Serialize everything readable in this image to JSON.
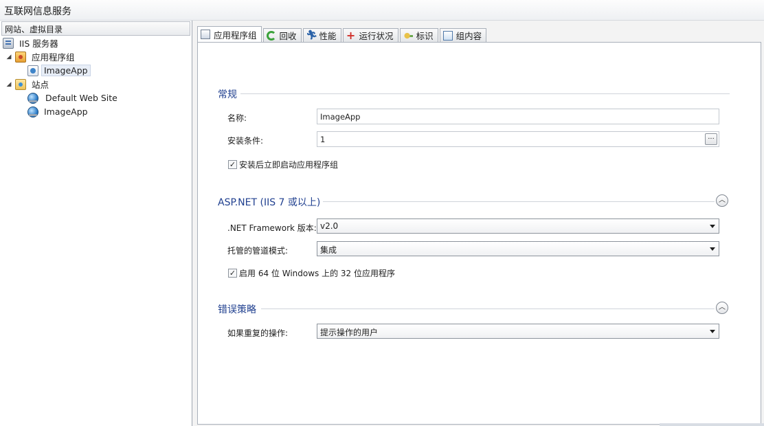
{
  "window": {
    "title": "互联网信息服务"
  },
  "left_pane": {
    "header": "网站、虚拟目录",
    "tree": [
      {
        "label": "IIS 服务器",
        "icon": "server-icon"
      },
      {
        "label": "应用程序组",
        "icon": "app-pool-folder-icon",
        "expanded": true
      },
      {
        "label": "ImageApp",
        "icon": "app-pool-icon",
        "selected": true
      },
      {
        "label": "站点",
        "icon": "sites-folder-icon",
        "expanded": true
      },
      {
        "label": "Default Web Site",
        "icon": "globe-icon"
      },
      {
        "label": "ImageApp",
        "icon": "globe-icon"
      }
    ]
  },
  "tabs": [
    {
      "label": "应用程序组",
      "icon": "app-pool-icon",
      "active": true
    },
    {
      "label": "回收",
      "icon": "recycle-icon"
    },
    {
      "label": "性能",
      "icon": "performance-icon"
    },
    {
      "label": "运行状况",
      "icon": "health-icon"
    },
    {
      "label": "标识",
      "icon": "identity-key-icon"
    },
    {
      "label": "组内容",
      "icon": "group-content-icon"
    }
  ],
  "general": {
    "title": "常规",
    "name_label": "名称:",
    "name_value": "ImageApp",
    "condition_label": "安装条件:",
    "condition_value": "1",
    "browse_label": "...",
    "start_after_install_label": "安装后立即启动应用程序组",
    "start_after_install_checked": true
  },
  "aspnet": {
    "title": "ASP.NET (IIS 7 或以上)",
    "framework_label": ".NET Framework 版本:",
    "framework_value": "v2.0",
    "pipeline_label": "托管的管道模式:",
    "pipeline_value": "集成",
    "enable32_label": "启用 64 位 Windows 上的 32 位应用程序",
    "enable32_checked": true
  },
  "error_policy": {
    "title": "错误策略",
    "repeat_label": "如果重复的操作:",
    "repeat_value": "提示操作的用户"
  }
}
